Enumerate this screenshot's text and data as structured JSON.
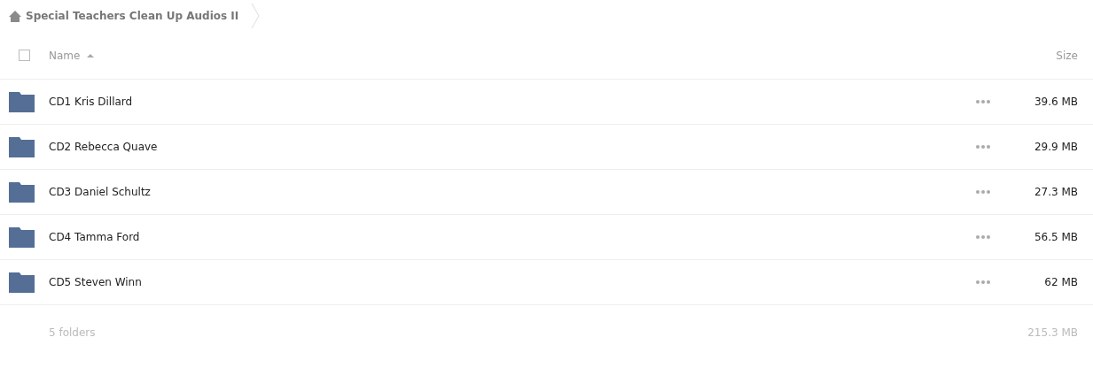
{
  "breadcrumb": {
    "items": [
      {
        "label": "Special Teachers Clean Up Audios II"
      }
    ]
  },
  "table": {
    "select_all": {
      "checked": false
    },
    "columns": [
      {
        "label": "Name",
        "sorted": true
      },
      {
        "label": "Size",
        "sorted": false
      }
    ],
    "rows": [
      {
        "name": "CD1 Kris Dillard",
        "size": "39.6 MB"
      },
      {
        "name": "CD2 Rebecca Quave",
        "size": "29.9 MB"
      },
      {
        "name": "CD3 Daniel Schultz",
        "size": "27.3 MB"
      },
      {
        "name": "CD4 Tamma Ford",
        "size": "56.5 MB"
      },
      {
        "name": "CD5 Steven Winn",
        "size": "62 MB"
      }
    ]
  },
  "footer": {
    "count": "5 folders",
    "total": "215.3 MB"
  }
}
